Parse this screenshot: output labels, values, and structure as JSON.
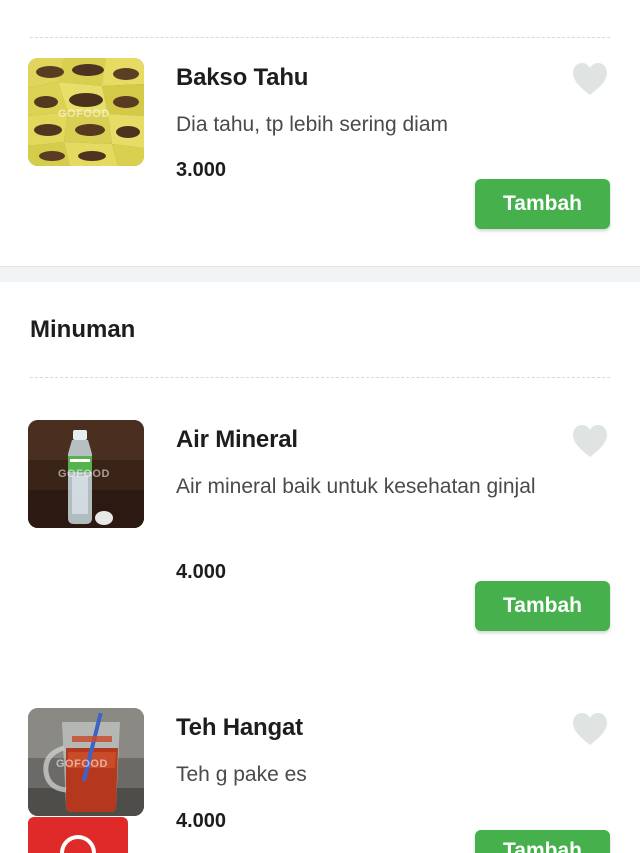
{
  "items_top": [
    {
      "name": "Bakso Tahu",
      "desc": "Dia tahu, tp lebih sering diam",
      "price": "3.000",
      "button": "Tambah",
      "watermark": "GOFOOD"
    }
  ],
  "section": {
    "title": "Minuman"
  },
  "items_minuman": [
    {
      "name": "Air Mineral",
      "desc": "Air mineral baik untuk kesehatan ginjal",
      "price": "4.000",
      "button": "Tambah",
      "watermark": "GOFOOD"
    },
    {
      "name": "Teh Hangat",
      "desc": "Teh g pake es",
      "price": "4.000",
      "button": "Tambah",
      "watermark": "GOFOOD"
    }
  ],
  "icons": {
    "favorite": "heart-icon",
    "cart": "cart-icon"
  },
  "colors": {
    "accent": "#46b14c",
    "heart": "#dfe4e3",
    "fab": "#e02a2a"
  }
}
